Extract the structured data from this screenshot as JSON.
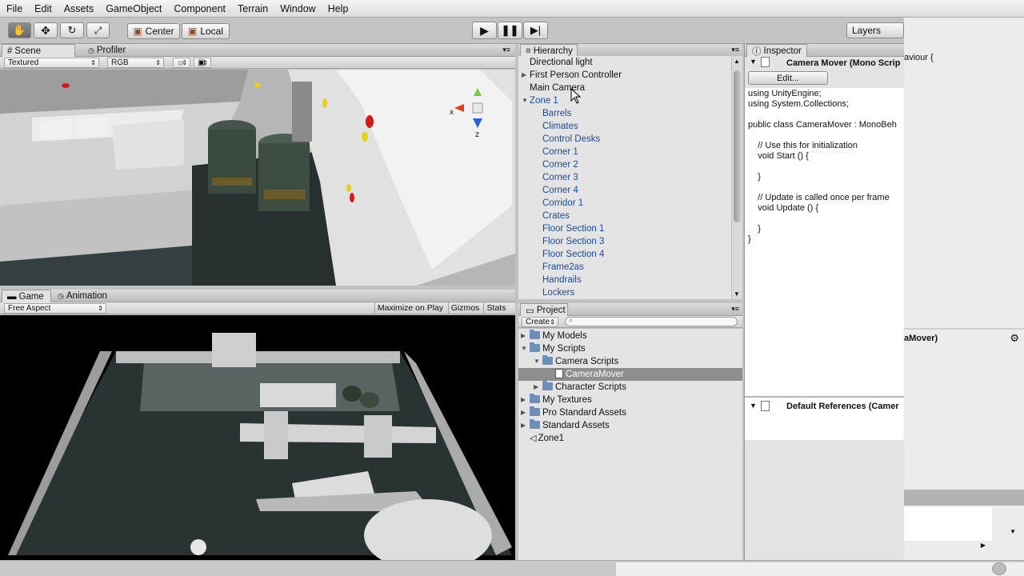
{
  "menu": [
    "File",
    "Edit",
    "Assets",
    "GameObject",
    "Component",
    "Terrain",
    "Window",
    "Help"
  ],
  "toolbar": {
    "center_label": "Center",
    "local_label": "Local",
    "layers_label": "Layers"
  },
  "scene": {
    "tab_scene": "Scene",
    "tab_profiler": "Profiler",
    "render_mode": "Textured",
    "color_mode": "RGB",
    "gizmo_x": "x",
    "gizmo_z": "z"
  },
  "game": {
    "tab_game": "Game",
    "tab_animation": "Animation",
    "aspect": "Free Aspect",
    "maximize": "Maximize on Play",
    "gizmos": "Gizmos",
    "stats": "Stats"
  },
  "hierarchy": {
    "tab": "Hierarchy",
    "items": [
      {
        "label": "Directional light",
        "indent": 0,
        "arrow": "",
        "color": "black"
      },
      {
        "label": "First Person Controller",
        "indent": 0,
        "arrow": "right",
        "color": "black"
      },
      {
        "label": "Main Camera",
        "indent": 0,
        "arrow": "",
        "color": "black"
      },
      {
        "label": "Zone 1",
        "indent": 0,
        "arrow": "down",
        "color": "blue"
      },
      {
        "label": "Barrels",
        "indent": 1,
        "arrow": "",
        "color": "blue"
      },
      {
        "label": "Climates",
        "indent": 1,
        "arrow": "",
        "color": "blue"
      },
      {
        "label": "Control Desks",
        "indent": 1,
        "arrow": "",
        "color": "blue"
      },
      {
        "label": "Corner 1",
        "indent": 1,
        "arrow": "",
        "color": "blue"
      },
      {
        "label": "Corner 2",
        "indent": 1,
        "arrow": "",
        "color": "blue"
      },
      {
        "label": "Corner 3",
        "indent": 1,
        "arrow": "",
        "color": "blue"
      },
      {
        "label": "Corner 4",
        "indent": 1,
        "arrow": "",
        "color": "blue"
      },
      {
        "label": "Corridor 1",
        "indent": 1,
        "arrow": "",
        "color": "blue"
      },
      {
        "label": "Crates",
        "indent": 1,
        "arrow": "",
        "color": "blue"
      },
      {
        "label": "Floor Section 1",
        "indent": 1,
        "arrow": "",
        "color": "blue"
      },
      {
        "label": "Floor Section 3",
        "indent": 1,
        "arrow": "",
        "color": "blue"
      },
      {
        "label": "Floor Section 4",
        "indent": 1,
        "arrow": "",
        "color": "blue"
      },
      {
        "label": "Frame2as",
        "indent": 1,
        "arrow": "",
        "color": "blue"
      },
      {
        "label": "Handrails",
        "indent": 1,
        "arrow": "",
        "color": "blue"
      },
      {
        "label": "Lockers",
        "indent": 1,
        "arrow": "",
        "color": "blue"
      }
    ]
  },
  "project": {
    "tab": "Project",
    "create_label": "Create",
    "items": [
      {
        "label": "My Models",
        "indent": 0,
        "arrow": "right",
        "kind": "folder"
      },
      {
        "label": "My Scripts",
        "indent": 0,
        "arrow": "down",
        "kind": "folder"
      },
      {
        "label": "Camera Scripts",
        "indent": 1,
        "arrow": "down",
        "kind": "folder"
      },
      {
        "label": "CameraMover",
        "indent": 2,
        "arrow": "",
        "kind": "script",
        "selected": true
      },
      {
        "label": "Character Scripts",
        "indent": 1,
        "arrow": "right",
        "kind": "folder"
      },
      {
        "label": "My Textures",
        "indent": 0,
        "arrow": "right",
        "kind": "folder"
      },
      {
        "label": "Pro Standard Assets",
        "indent": 0,
        "arrow": "right",
        "kind": "folder"
      },
      {
        "label": "Standard Assets",
        "indent": 0,
        "arrow": "right",
        "kind": "folder"
      },
      {
        "label": "Zone1",
        "indent": 0,
        "arrow": "",
        "kind": "unity"
      }
    ]
  },
  "inspector": {
    "tab": "Inspector",
    "component_title": "Camera Mover (Mono Scrip",
    "edit_button": "Edit...",
    "code_lines": [
      "using UnityEngine;",
      "using System.Collections;",
      "",
      "public class CameraMover : MonoBeh",
      "",
      "    // Use this for initialization",
      "    void Start () {",
      "",
      "    }",
      "",
      "    // Update is called once per frame",
      "    void Update () {",
      "",
      "    }",
      "}"
    ],
    "default_refs": "Default References (Camer"
  },
  "overlay": {
    "text_top": "aviour {",
    "text_mid": "aMover)"
  },
  "colors": {
    "hierarchy_blue": "#1b4aa0",
    "selection": "#8e8e8e",
    "panel_bg": "#e4e4e4"
  }
}
